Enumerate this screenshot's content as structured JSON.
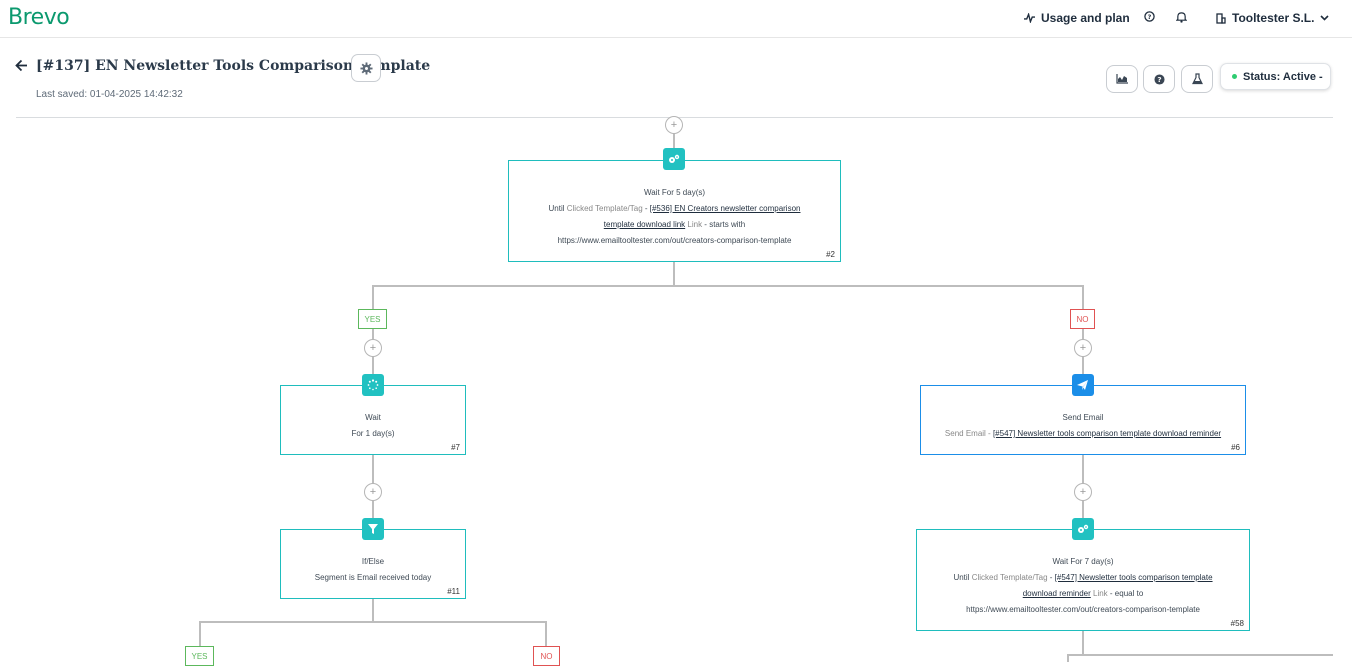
{
  "app": {
    "logo": "Brevo"
  },
  "topbar": {
    "usage_label": "Usage and plan",
    "account_label": "Tooltester S.L."
  },
  "header": {
    "title": "[#137] EN Newsletter Tools Comparison Template",
    "last_saved": "Last saved: 01-04-2025 14:42:32",
    "status_label": "Status: Active -"
  },
  "workflow": {
    "n2": {
      "title": "Wait For 5 day(s)",
      "line1_prefix": "Until",
      "line1_muted": "Clicked Template/Tag",
      "line1_sep": " - ",
      "line1_link": "[#536] EN Creators newsletter comparison",
      "line2_link": "template download link",
      "line2_muted": " Link",
      "line2_rest": " - starts with",
      "line3": "https://www.emailtooltester.com/out/creators-comparison-template",
      "id": "#2"
    },
    "yes_label": "YES",
    "no_label": "NO",
    "n7": {
      "title": "Wait",
      "line1": "For 1 day(s)",
      "id": "#7"
    },
    "n6": {
      "title": "Send Email",
      "line1_muted": "Send Email - ",
      "line1_link": "[#547] Newsletter tools comparison template download reminder",
      "id": "#6"
    },
    "n11": {
      "title": "If/Else",
      "line1": "Segment is Email received today",
      "id": "#11"
    },
    "n58": {
      "title": "Wait For 7 day(s)",
      "line1_prefix": "Until ",
      "line1_muted": "Clicked Template/Tag",
      "line1_sep": " - ",
      "line1_link": "[#547] Newsletter tools comparison template",
      "line2_link": "download reminder",
      "line2_muted": " Link",
      "line2_rest": " - equal to",
      "line3": "https://www.emailtooltester.com/out/creators-comparison-template",
      "id": "#58"
    },
    "plus_symbol": "+"
  },
  "colors": {
    "brand": "#0b996e",
    "teal": "#21c1c1",
    "blue": "#1b8ee8",
    "yes": "#5cb85c",
    "no": "#e05252",
    "active": "#2ecc71"
  },
  "icons": [
    "activity-icon",
    "help-icon",
    "bell-icon",
    "building-icon",
    "chevron-down-icon",
    "arrow-left-icon",
    "gear-icon",
    "chart-icon",
    "flask-icon",
    "gears-icon",
    "spinner-icon",
    "filter-icon",
    "paper-plane-icon"
  ]
}
